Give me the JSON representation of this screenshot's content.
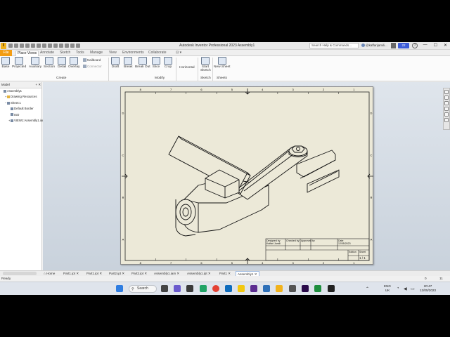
{
  "titlebar": {
    "app_title": "Autodesk Inventor Professional 2023    Assembly1",
    "search_placeholder": "Search Help & Commands...",
    "user": "@kaffarijamili...",
    "badge": "22",
    "help": "?",
    "minimize": "—",
    "maximize": "☐",
    "close": "✕"
  },
  "ribbon_tabs": [
    "File",
    "Place Views",
    "Annotate",
    "Sketch",
    "Tools",
    "Manage",
    "View",
    "Environments",
    "Collaborate",
    "⊡ ▾"
  ],
  "ribbon": {
    "create": {
      "label": "Create",
      "buttons": [
        "Base",
        "Projected",
        "Auxiliary",
        "Section",
        "Detail",
        "Overlay"
      ],
      "small": [
        "Nailboard",
        "Connector"
      ]
    },
    "modify": {
      "label": "Modify",
      "buttons": [
        "Draft",
        "Break",
        "Break Out",
        "Slice",
        "Crop"
      ]
    },
    "sketch_group": {
      "label": "Sketch",
      "buttons": [
        "Horizontal",
        "Start Sketch"
      ]
    },
    "sheets": {
      "label": "Sheets",
      "buttons": [
        "New Sheet"
      ]
    }
  },
  "browser": {
    "header": "Model",
    "plus": "+",
    "close": "✕",
    "items": [
      {
        "label": "Assembly1",
        "indent": 0,
        "icon": "drawing-icon",
        "exp": ""
      },
      {
        "label": "Drawing Resources",
        "indent": 1,
        "icon": "folder-icon",
        "exp": "+"
      },
      {
        "label": "Sheet:1",
        "indent": 1,
        "icon": "sheet-icon",
        "exp": "−"
      },
      {
        "label": "Default Border",
        "indent": 2,
        "icon": "border-icon",
        "exp": ""
      },
      {
        "label": "ISO",
        "indent": 2,
        "icon": "titleblock-icon",
        "exp": ""
      },
      {
        "label": "VIEW1:Assembly1.iam",
        "indent": 2,
        "icon": "view-icon",
        "exp": "+"
      }
    ]
  },
  "sheet": {
    "zone_numbers": [
      "8",
      "7",
      "6",
      "5",
      "4",
      "3",
      "2",
      "1"
    ],
    "zone_letters": [
      "D",
      "C",
      "B",
      "A"
    ],
    "title_block": {
      "designed_by": "Designed by",
      "checked_by": "Checked by",
      "approved_by": "Approved by",
      "date_label": "Date",
      "date_value": "12/05/2023",
      "author": "Kaffari Jamili",
      "edition": "Edition",
      "sheet": "Sheet",
      "sheet_value": "1 / 1"
    }
  },
  "doc_tabs": [
    "Home",
    "Part1.ipt",
    "Part1.ipt",
    "Part2.ipt",
    "Part2.ipt",
    "Assembly1.iam",
    "Assembly1.ipt",
    "Part1",
    "Assembly1"
  ],
  "status": {
    "left": "Ready",
    "right1": "0",
    "right2": "11"
  },
  "taskbar": {
    "search": "Search",
    "lang1": "ENG",
    "lang2": "UK",
    "time": "20:47",
    "date": "12/05/2023"
  }
}
